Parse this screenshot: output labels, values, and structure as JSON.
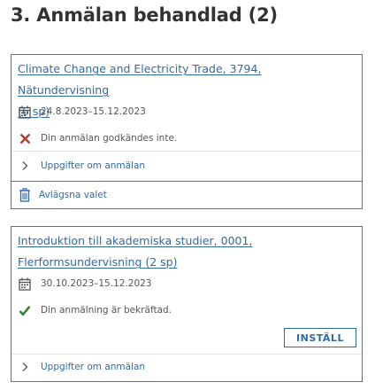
{
  "section": {
    "title": "3. Anmälan behandlad (2)"
  },
  "cards": [
    {
      "title_parts": [
        "Climate Change and Electricity Trade, 3794, Nätundervisning",
        "(6 sp)"
      ],
      "dates": "24.8.2023–15.12.2023",
      "status": "Din anmälan godkändes inte.",
      "status_type": "rejected",
      "details_label": "Uppgifter om anmälan",
      "remove_label": "Avlägsna valet"
    },
    {
      "title_parts": [
        "Introduktion till akademiska studier, 0001,",
        "Flerformsundervisning (2 sp)"
      ],
      "dates": "30.10.2023–15.12.2023",
      "status": "Din anmälning är bekräftad.",
      "status_type": "confirmed",
      "cancel_label": "INSTÄLL",
      "details_label": "Uppgifter om anmälan"
    }
  ],
  "colors": {
    "link": "#2f6aa8",
    "reject": "#c0392b",
    "confirm": "#2e7d32",
    "border": "#6e6e6e"
  },
  "icons": {
    "calendar": "calendar-icon",
    "reject": "x-icon",
    "confirm": "check-icon",
    "expand": "chevron-right-icon",
    "remove": "trash-icon"
  }
}
